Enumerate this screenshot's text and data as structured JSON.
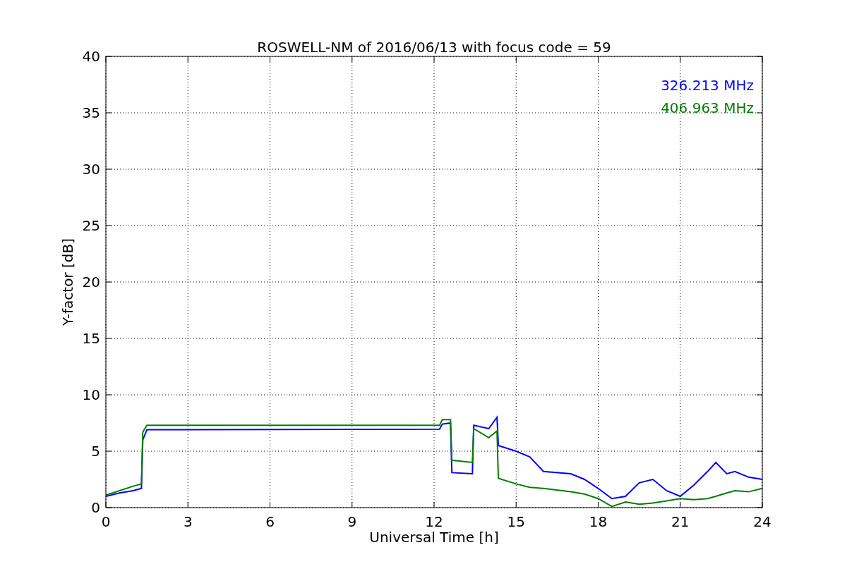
{
  "chart_data": {
    "type": "line",
    "title": "ROSWELL-NM of 2016/06/13 with focus code = 59",
    "xlabel": "Universal Time [h]",
    "ylabel": "Y-factor [dB]",
    "x": [
      0,
      0.5,
      1.0,
      1.3,
      1.35,
      1.5,
      12.2,
      12.3,
      12.6,
      12.65,
      13.4,
      13.45,
      14.0,
      14.3,
      14.35,
      15.0,
      15.5,
      16.0,
      17.0,
      17.5,
      18.0,
      18.5,
      19.0,
      19.5,
      20.0,
      20.5,
      21.0,
      21.5,
      22.0,
      22.3,
      22.7,
      23.0,
      23.5,
      24
    ],
    "series": [
      {
        "name": "326.213 MHz",
        "color": "#0000ff",
        "values": [
          1.0,
          1.3,
          1.5,
          1.7,
          6.0,
          6.9,
          6.95,
          7.4,
          7.5,
          3.1,
          3.0,
          7.3,
          7.0,
          8.0,
          5.5,
          5.0,
          4.5,
          3.2,
          3.0,
          2.5,
          1.7,
          0.8,
          1.0,
          2.2,
          2.5,
          1.5,
          1.0,
          2.0,
          3.2,
          4.0,
          3.0,
          3.2,
          2.7,
          2.5
        ]
      },
      {
        "name": "406.963 MHz",
        "color": "#008000",
        "values": [
          1.1,
          1.5,
          1.9,
          2.1,
          6.7,
          7.3,
          7.3,
          7.8,
          7.8,
          4.2,
          4.0,
          7.0,
          6.2,
          6.8,
          2.6,
          2.1,
          1.8,
          1.7,
          1.4,
          1.2,
          0.8,
          0.1,
          0.5,
          0.3,
          0.4,
          0.6,
          0.8,
          0.7,
          0.8,
          1.0,
          1.3,
          1.5,
          1.4,
          1.7
        ]
      }
    ],
    "grid": true,
    "xlim": [
      0,
      24
    ],
    "ylim": [
      0,
      40
    ],
    "xticks": [
      0,
      3,
      6,
      9,
      12,
      15,
      18,
      21,
      24
    ],
    "yticks": [
      0,
      5,
      10,
      15,
      20,
      25,
      30,
      35,
      40
    ]
  }
}
